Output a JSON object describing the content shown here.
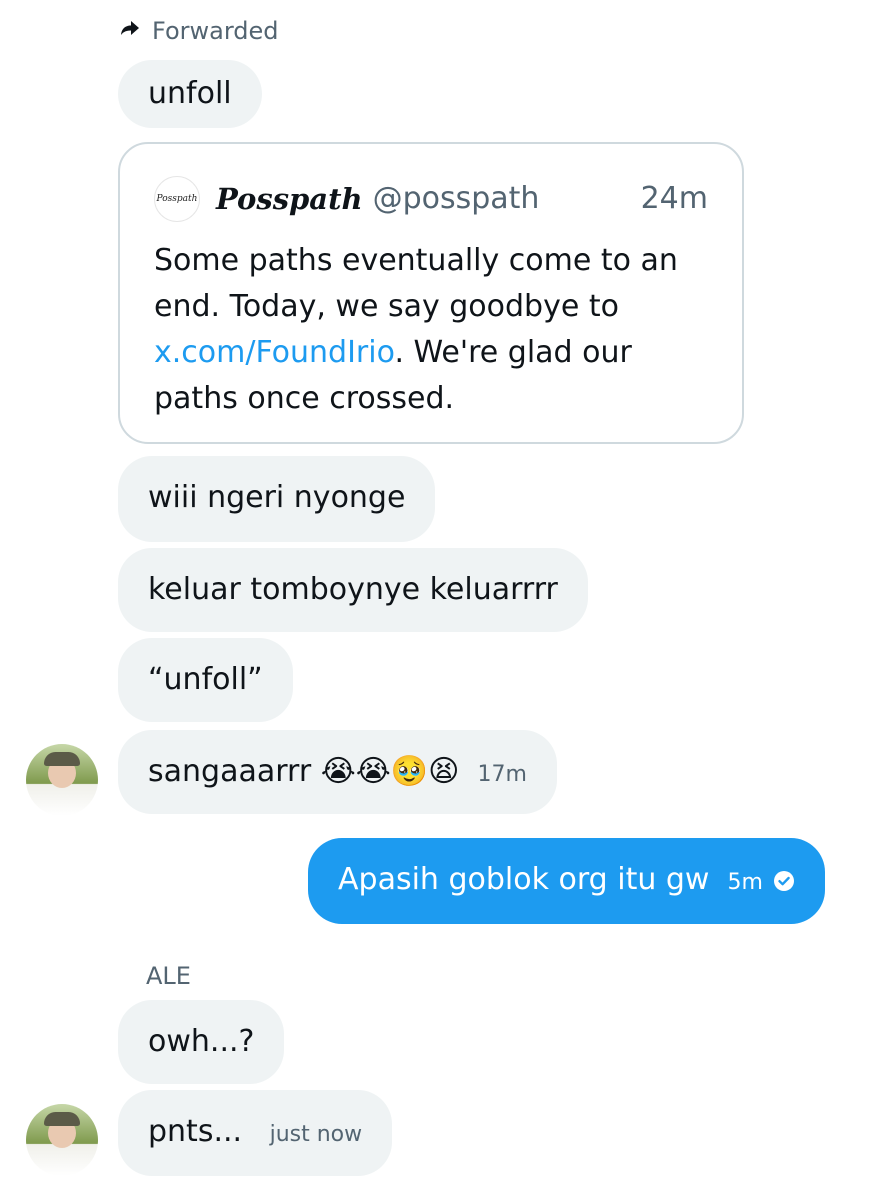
{
  "forwarded": {
    "icon": "forward-arrow-icon",
    "label": "Forwarded"
  },
  "messages": [
    {
      "text": "unfoll"
    },
    {
      "text": "wiii ngeri ",
      "extra": "nyonge"
    },
    {
      "text": "keluar tomboynye keluarrrr"
    },
    {
      "text": "“unfoll”"
    },
    {
      "text": "sangaaarrr ",
      "emojis": "😭😭🥹😫",
      "time": "17m"
    },
    {
      "text": "Apasih goblok org itu gw",
      "time": "5m",
      "status_icon": "read-check-icon"
    },
    {
      "text": "owh...?"
    },
    {
      "text": "pnts... ",
      "time": "just now"
    }
  ],
  "quote": {
    "logo_text": "Posspath",
    "name": "Posspath",
    "handle": "@posspath",
    "time": "24m",
    "body_before": "Some paths eventually come to an end. Today, we say goodbye to ",
    "link": "x.com/FoundIrio",
    "body_after": ". We're glad our paths once crossed."
  },
  "sender": {
    "name": "ALE"
  },
  "colors": {
    "sent_bubble": "#1d9bf0",
    "received_bubble": "#eff3f4",
    "muted_text": "#536471",
    "link": "#1d9bf0"
  }
}
